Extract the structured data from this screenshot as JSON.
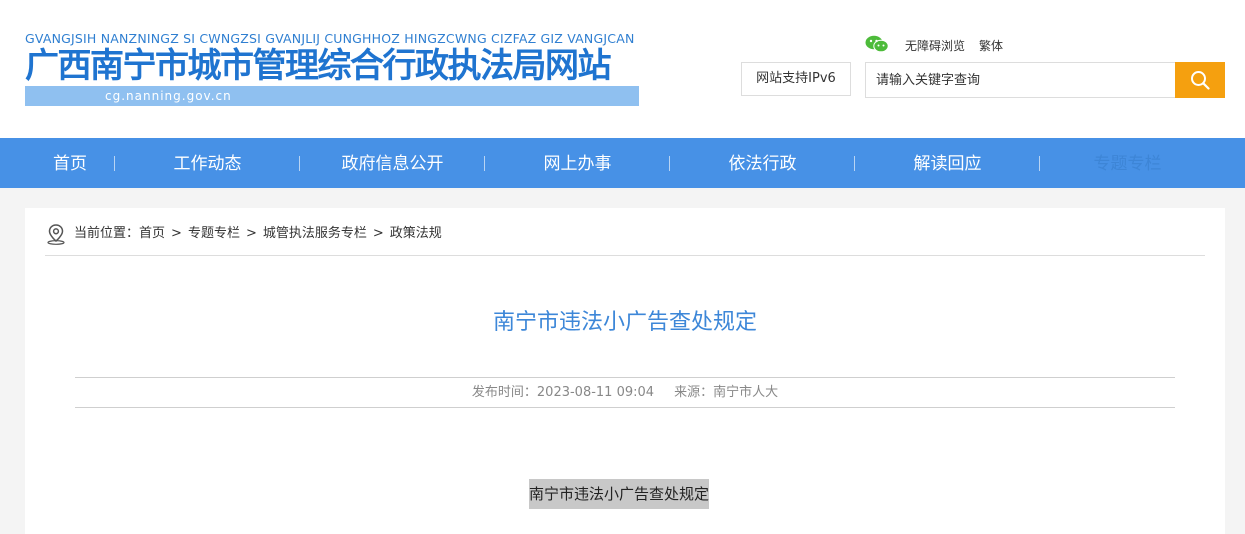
{
  "header": {
    "logo_pinyin": "GVANGJSIH NANZNINGZ SI CWNGZSI GVANJLIJ CUNGHHOZ HINGZCWNG CIZFAZ GIZ VANGJCAN",
    "logo_title": "广西南宁市城市管理综合行政执法局网站",
    "logo_domain": "cg.nanning.gov.cn",
    "accessibility_label": "无障碍浏览",
    "traditional_label": "繁体",
    "ipv6_label": "网站支持IPv6",
    "search_placeholder": "请输入关键字查询",
    "icons": {
      "wechat": "wechat-icon",
      "search": "search-icon"
    },
    "colors": {
      "accent": "#4791e6",
      "search_button": "#f5a00f",
      "wechat": "#4dbb3a"
    }
  },
  "nav": {
    "items": [
      {
        "label": "首页"
      },
      {
        "label": "工作动态"
      },
      {
        "label": "政府信息公开"
      },
      {
        "label": "网上办事"
      },
      {
        "label": "依法行政"
      },
      {
        "label": "解读回应"
      },
      {
        "label": "专题专栏"
      }
    ]
  },
  "breadcrumb": {
    "prefix": "当前位置：",
    "items": [
      "首页",
      "专题专栏",
      "城管执法服务专栏",
      "政策法规"
    ],
    "separator": ">",
    "icon": "location-pin-icon"
  },
  "article": {
    "title": "南宁市违法小广告查处规定",
    "publish_label": "发布时间：",
    "publish_time": "2023-08-11 09:04",
    "source_label": "来源：",
    "source": "南宁市人大",
    "body_title": "南宁市违法小广告查处规定"
  }
}
